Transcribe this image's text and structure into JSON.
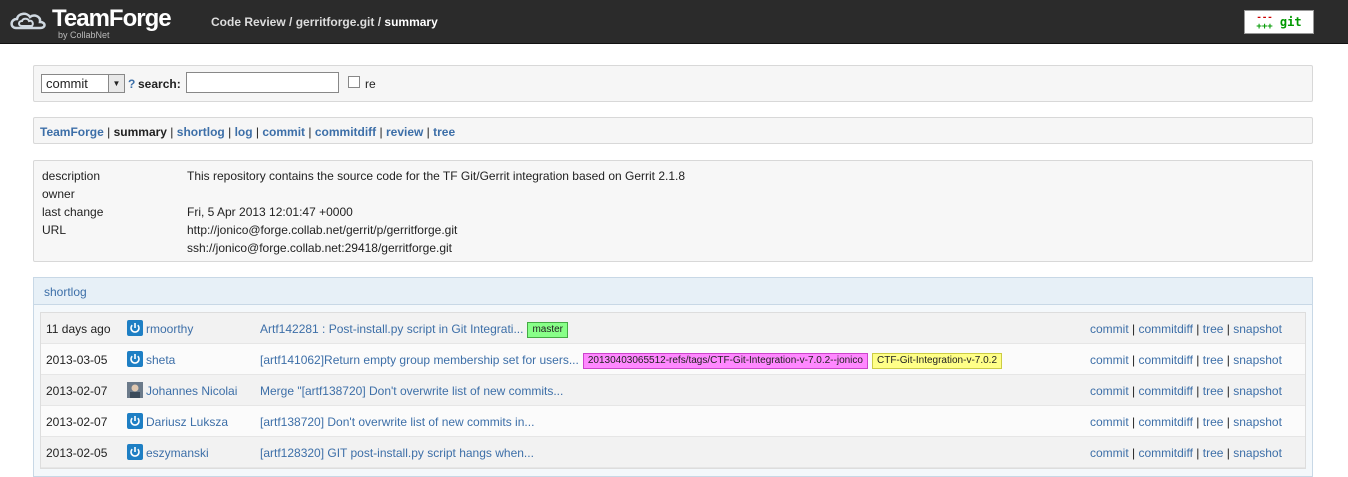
{
  "header": {
    "brand": "TeamForge",
    "byline": "by CollabNet",
    "breadcrumb": {
      "part1": "Code Review",
      "sep1": " / ",
      "part2": "gerritforge.git",
      "sep2": " / ",
      "current": "summary"
    },
    "git_button": {
      "minus": "---",
      "plus": "+++",
      "label": "git"
    }
  },
  "search": {
    "select_value": "commit",
    "help": "?",
    "label": "search:",
    "input_value": "",
    "regex_label": "re"
  },
  "nav": {
    "items": [
      "TeamForge",
      "summary",
      "shortlog",
      "log",
      "commit",
      "commitdiff",
      "review",
      "tree"
    ],
    "current": "summary"
  },
  "project": {
    "description_label": "description",
    "description": "This repository contains the source code for the TF Git/Gerrit integration based on Gerrit 2.1.8",
    "owner_label": "owner",
    "owner": "",
    "last_change_label": "last change",
    "last_change": "Fri, 5 Apr 2013 12:01:47 +0000",
    "url_label": "URL",
    "urls": [
      "http://jonico@forge.collab.net/gerrit/p/gerritforge.git",
      "ssh://jonico@forge.collab.net:29418/gerritforge.git"
    ]
  },
  "shortlog": {
    "title": "shortlog",
    "links": [
      "commit",
      "commitdiff",
      "tree",
      "snapshot"
    ],
    "rows": [
      {
        "age": "11 days ago",
        "author": "rmoorthy",
        "avatar": "power-icon",
        "subject": "Artf142281 : Post-install.py script in Git Integrati...",
        "badges": [
          {
            "text": "master",
            "color": "green"
          }
        ]
      },
      {
        "age": "2013-03-05",
        "author": "sheta",
        "avatar": "power-icon",
        "subject": "[artf141062]Return empty group membership set for users...",
        "badges": [
          {
            "text": "20130403065512-refs/tags/CTF-Git-Integration-v-7.0.2--jonico",
            "color": "pink"
          },
          {
            "text": "CTF-Git-Integration-v-7.0.2",
            "color": "yellow"
          }
        ]
      },
      {
        "age": "2013-02-07",
        "author": "Johannes Nicolai",
        "avatar": "photo-avatar",
        "subject": "Merge \"[artf138720] Don't overwrite list of new commits...",
        "badges": []
      },
      {
        "age": "2013-02-07",
        "author": "Dariusz Luksza",
        "avatar": "power-icon",
        "subject": "[artf138720] Don't overwrite list of new commits in...",
        "badges": []
      },
      {
        "age": "2013-02-05",
        "author": "eszymanski",
        "avatar": "power-icon",
        "subject": "[artf128320] GIT post-install.py script hangs when...",
        "badges": []
      }
    ]
  }
}
